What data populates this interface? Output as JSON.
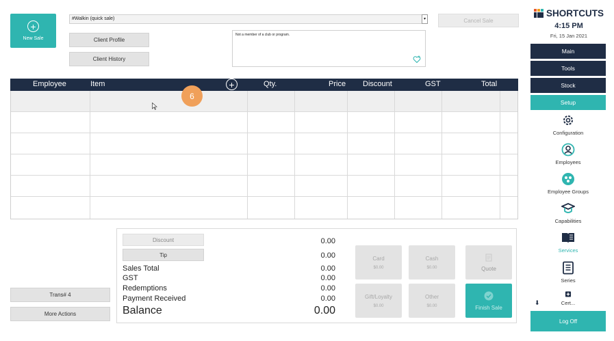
{
  "new_sale": {
    "label": "New Sale"
  },
  "client": {
    "selected": "#Walkin (quick sale)",
    "profile_label": "Client Profile",
    "history_label": "Client History",
    "membership_note": "Not a member of a club or program."
  },
  "cancel_sale_label": "Cancel Sale",
  "table": {
    "columns": [
      "Employee",
      "Item",
      "Qty.",
      "Price",
      "Discount",
      "GST",
      "Total"
    ],
    "rows": [],
    "step_badge": "6"
  },
  "bottom": {
    "trans_label": "Trans# 4",
    "more_actions_label": "More Actions",
    "discount_label": "Discount",
    "tip_label": "Tip",
    "discount_value": "0.00",
    "tip_value": "0.00",
    "summary": [
      {
        "label": "Sales Total",
        "value": "0.00"
      },
      {
        "label": "GST",
        "value": "0.00"
      },
      {
        "label": "Redemptions",
        "value": "0.00"
      },
      {
        "label": "Payment Received",
        "value": "0.00"
      }
    ],
    "balance_label": "Balance",
    "balance_value": "0.00"
  },
  "payments": {
    "card": {
      "label": "Card",
      "amount": "$0.00"
    },
    "cash": {
      "label": "Cash",
      "amount": "$0.00"
    },
    "quote": {
      "label": "Quote"
    },
    "gift": {
      "label": "Gift/Loyalty",
      "amount": "$0.00"
    },
    "other": {
      "label": "Other",
      "amount": "$0.00"
    },
    "finish": {
      "label": "Finish Sale"
    }
  },
  "sidebar": {
    "brand": "SHORTCUTS",
    "time": "4:15 PM",
    "date": "Fri, 15 Jan 2021",
    "nav": [
      {
        "label": "Main"
      },
      {
        "label": "Tools"
      },
      {
        "label": "Stock"
      },
      {
        "label": "Setup",
        "active": true
      }
    ],
    "items": [
      {
        "label": "Configuration",
        "icon": "gear-icon"
      },
      {
        "label": "Employees",
        "icon": "person-icon"
      },
      {
        "label": "Employee Groups",
        "icon": "group-icon"
      },
      {
        "label": "Capabilities",
        "icon": "graduation-cap-icon"
      },
      {
        "label": "Services",
        "icon": "book-icon",
        "selected": true
      },
      {
        "label": "Series",
        "icon": "list-book-icon"
      },
      {
        "label": "Cert...",
        "icon": "medical-plus-icon"
      }
    ],
    "log_off_label": "Log Off"
  },
  "colors": {
    "navy": "#1f2d45",
    "teal": "#2fb5b0",
    "badge": "#f0a05a"
  }
}
